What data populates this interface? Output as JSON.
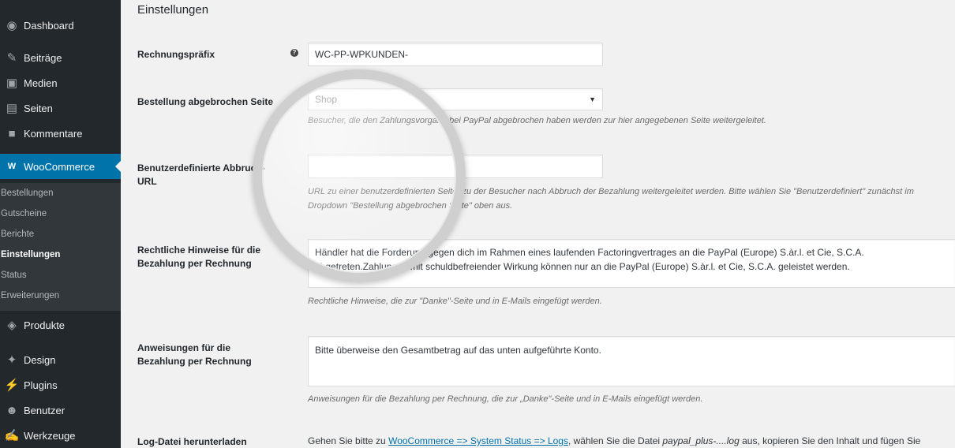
{
  "sidebar": {
    "items": [
      {
        "label": "Dashboard",
        "icon": "dashboard-icon",
        "glyph": "◉"
      },
      {
        "label": "Beiträge",
        "icon": "pin-icon",
        "glyph": "✎"
      },
      {
        "label": "Medien",
        "icon": "media-icon",
        "glyph": "▣"
      },
      {
        "label": "Seiten",
        "icon": "pages-icon",
        "glyph": "▤"
      },
      {
        "label": "Kommentare",
        "icon": "comment-icon",
        "glyph": "■"
      },
      {
        "label": "WooCommerce",
        "icon": "woocommerce-icon",
        "glyph": "W"
      },
      {
        "label": "Produkte",
        "icon": "products-icon",
        "glyph": "◈"
      },
      {
        "label": "Design",
        "icon": "design-icon",
        "glyph": "✦"
      },
      {
        "label": "Plugins",
        "icon": "plugins-icon",
        "glyph": "⚡"
      },
      {
        "label": "Benutzer",
        "icon": "users-icon",
        "glyph": "☻"
      },
      {
        "label": "Werkzeuge",
        "icon": "tools-icon",
        "glyph": "✍"
      }
    ],
    "submenu": [
      "Bestellungen",
      "Gutscheine",
      "Berichte",
      "Einstellungen",
      "Status",
      "Erweiterungen"
    ]
  },
  "settings": {
    "section_title": "Einstellungen",
    "invoice_prefix": {
      "label": "Rechnungspräfix",
      "value": "WC-PP-WPKUNDEN-",
      "help": "?"
    },
    "cancel_page": {
      "label": "Bestellung abgebrochen Seite",
      "value": "Shop",
      "description": "Besucher, die den Zahlungsvorgang bei PayPal abgebrochen haben werden zur hier angegebenen Seite weitergeleitet."
    },
    "custom_cancel_url": {
      "label": "Benutzerdefinierte Abbruch-URL",
      "value": "",
      "description": "URL zu einer benutzerdefinierten Seite, zu der Besucher nach Abbruch der Bezahlung weitergeleitet werden. Bitte wählen Sie \"Benutzerdefiniert\" zunächst im Dropdown \"Bestellung abgebrochen Seite\" oben aus."
    },
    "legal_notice": {
      "label": "Rechtliche Hinweise für die Bezahlung per Rechnung",
      "value": "Händler hat die Forderung gegen dich im Rahmen eines laufenden Factoringvertrages an die PayPal (Europe) S.àr.l. et Cie, S.C.A. abgetreten.Zahlungen mit schuldbefreiender Wirkung können nur an die PayPal (Europe) S.àr.l. et Cie, S.C.A. geleistet werden.",
      "description": "Rechtliche Hinweise, die zur \"Danke\"-Seite und in E-Mails eingefügt werden."
    },
    "instructions": {
      "label": "Anweisungen für die Bezahlung per Rechnung",
      "value": "Bitte überweise den Gesamtbetrag auf das unten aufgeführte Konto.",
      "description": "Anweisungen für die Bezahlung per Rechnung, die zur „Danke\"-Seite und in E-Mails eingefügt werden."
    },
    "log_download": {
      "label": "Log-Datei herunterladen",
      "text_before": "Gehen Sie bitte zu ",
      "link": "WooCommerce => System Status => Logs",
      "text_middle": ", wählen Sie die Datei ",
      "file": "paypal_plus-....log",
      "text_after": " aus, kopieren Sie den Inhalt und fügen Sie"
    }
  }
}
